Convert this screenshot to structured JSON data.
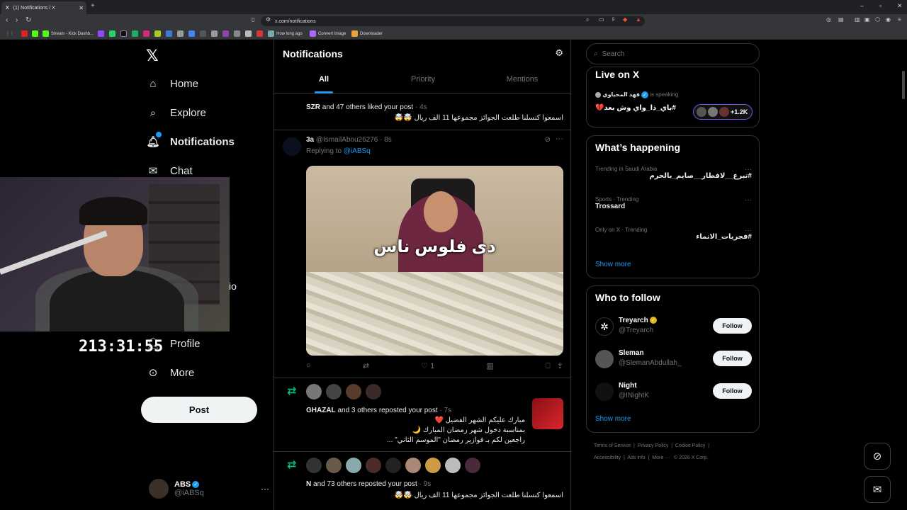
{
  "browser": {
    "tab_title": "(1) Notifications / X",
    "url": "x.com/notifications",
    "bookmarks": [
      "Stream - Kick Dashb...",
      "How long ago",
      "Convert Image",
      "Downloader"
    ],
    "ext_badge": "10"
  },
  "sidebar": {
    "items": [
      {
        "label": "Home",
        "icon": "home-icon"
      },
      {
        "label": "Explore",
        "icon": "search-icon"
      },
      {
        "label": "Notifications",
        "icon": "bell-icon"
      },
      {
        "label": "Chat",
        "icon": "mail-icon"
      },
      {
        "label": "Profile",
        "icon": "person-icon"
      },
      {
        "label": "More",
        "icon": "more-icon"
      }
    ],
    "partial_text": "io",
    "post_label": "Post",
    "account": {
      "name": "ABS",
      "handle": "@iABSq"
    }
  },
  "overlay": {
    "timer": "213:31:55"
  },
  "main": {
    "title": "Notifications",
    "tabs": [
      "All",
      "Priority",
      "Mentions"
    ],
    "n1": {
      "name": "SZR",
      "text": " and 47 others liked your post",
      "time": " · 4s",
      "quote": "اسمعوا كنسلنا طلعت الجوائز مجموعها 11 الف ريال 🤯🤯"
    },
    "tweet": {
      "name": "3a",
      "handle": "@IsmailAbou26276",
      "time": "· 8s",
      "replying": "Replying to ",
      "replying_to": "@iABSq",
      "caption": "دى فلوس ناس",
      "likes": "1"
    },
    "n2": {
      "name": "GHAZAL",
      "text": " and 3 others reposted your post",
      "time": " · 7s",
      "line1": "مبارك عليكم الشهر الفضيل ❤️",
      "line2": "بمناسبة دخول شهر رمضان المبارك 🌙",
      "line3": "راجعين لكم بـ فوازير رمضان \"الموسم الثاني\" ..."
    },
    "n3": {
      "name": "N",
      "text": " and 73 others reposted your post",
      "time": " · 9s",
      "quote": "اسمعوا كنسلنا طلعت الجوائز مجموعها 11 الف ريال 🤯🤯"
    }
  },
  "right": {
    "search_placeholder": "Search",
    "live": {
      "title": "Live on X",
      "host": "فهد المحياوي",
      "speaking": "is speaking",
      "topic": "#باي_ذا_واي وش بعد💔",
      "count": "+1.2K"
    },
    "happening": {
      "title": "What’s happening",
      "trends": [
        {
          "cat": "Trending in Saudi Arabia",
          "name": "#تبرع__لافطار__صايم_بالحرم"
        },
        {
          "cat": "Sports · Trending",
          "name": "Trossard"
        },
        {
          "cat": "Only on X · Trending",
          "name": "#فجريات_الانماء"
        }
      ],
      "show_more": "Show more"
    },
    "who": {
      "title": "Who to follow",
      "people": [
        {
          "name": "Treyarch",
          "handle": "@Treyarch",
          "button": "Follow"
        },
        {
          "name": "Sleman",
          "handle": "@SlemanAbdullah_",
          "button": "Follow"
        },
        {
          "name": "Night",
          "handle": "@INightK",
          "button": "Follow"
        }
      ],
      "show_more": "Show more"
    },
    "footer": {
      "line1": [
        "Terms of Service",
        "|",
        "Privacy Policy",
        "|",
        "Cookie Policy",
        "|"
      ],
      "line2": [
        "Accessibility",
        "|",
        "Ads info",
        "|",
        "More ···",
        "© 2026 X Corp."
      ]
    }
  }
}
